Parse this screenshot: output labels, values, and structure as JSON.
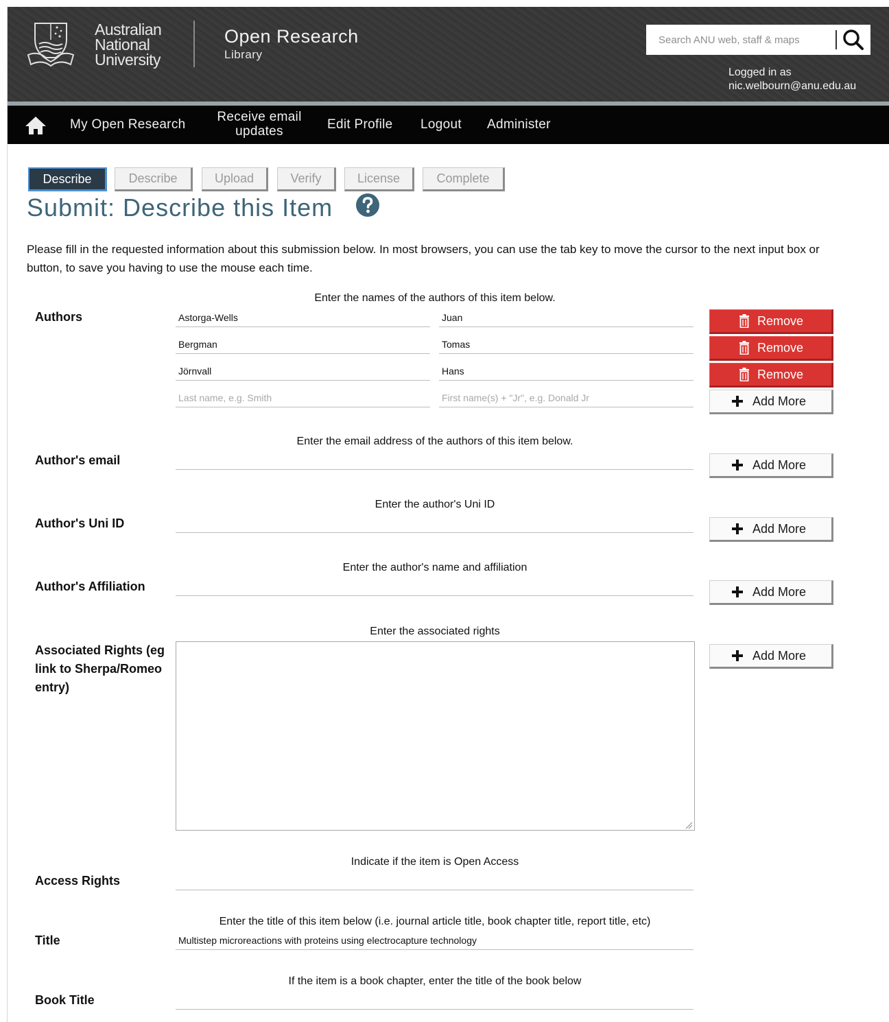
{
  "header": {
    "university": [
      "Australian",
      "National",
      "University"
    ],
    "site_title": "Open Research",
    "site_subtitle": "Library",
    "search_placeholder": "Search ANU web, staff & maps",
    "logged_in_label": "Logged in as",
    "logged_in_user": "nic.welbourn@anu.edu.au"
  },
  "nav": {
    "items": [
      "My Open Research",
      "Receive email",
      "updates",
      "Edit Profile",
      "Logout",
      "Administer"
    ]
  },
  "tabs": [
    "Describe",
    "Describe",
    "Upload",
    "Verify",
    "License",
    "Complete"
  ],
  "page": {
    "title": "Submit: Describe this Item",
    "intro": "Please fill in the requested information about this submission below. In most browsers, you can use the tab key to move the cursor to the next input box or button, to save you having to use the mouse each time."
  },
  "buttons": {
    "remove": "Remove",
    "add_more": "Add More"
  },
  "authors": {
    "label": "Authors",
    "hint": "Enter the names of the authors of this item below.",
    "rows": [
      {
        "last": "Astorga-Wells",
        "first": "Juan"
      },
      {
        "last": "Bergman",
        "first": "Tomas"
      },
      {
        "last": "Jörnvall",
        "first": "Hans"
      }
    ],
    "last_placeholder": "Last name, e.g. Smith",
    "first_placeholder": "First name(s) + \"Jr\", e.g. Donald Jr"
  },
  "email": {
    "label": "Author's email",
    "hint": "Enter the email address of the authors of this item below."
  },
  "uni_id": {
    "label": "Author's Uni ID",
    "hint": "Enter the author's Uni ID"
  },
  "affiliation": {
    "label": "Author's Affiliation",
    "hint": "Enter the author's name and affiliation"
  },
  "rights": {
    "label": "Associated Rights (eg link to Sherpa/Romeo entry)",
    "hint": "Enter the associated rights"
  },
  "access": {
    "label": "Access Rights",
    "hint": "Indicate if the item is Open Access"
  },
  "title_field": {
    "label": "Title",
    "hint": "Enter the title of this item below (i.e. journal article title, book chapter title, report title, etc)",
    "value": "Multistep microreactions with proteins using electrocapture technology"
  },
  "book_title": {
    "label": "Book Title",
    "hint": "If the item is a book chapter, enter the title of the book below"
  },
  "colors": {
    "accent": "#3e6579",
    "remove": "#d93431",
    "active_tab": "#2a3a47"
  },
  "icons": [
    "anu-crest-icon",
    "search-icon",
    "home-icon",
    "help-icon",
    "trash-icon",
    "plus-icon"
  ]
}
